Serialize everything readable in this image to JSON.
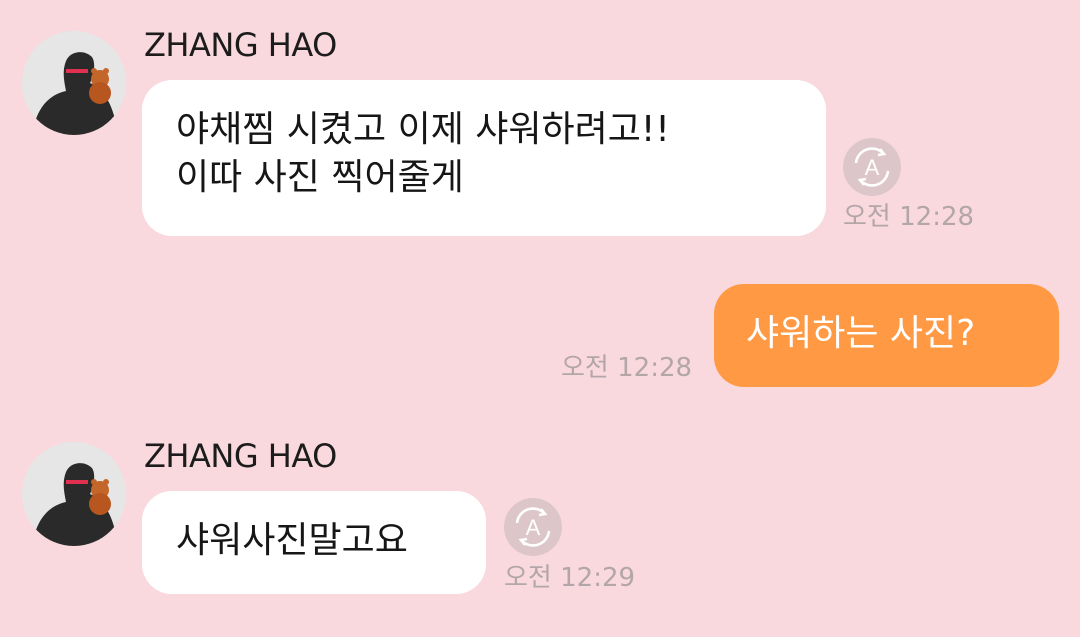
{
  "messages": [
    {
      "sender": "ZHANG HAO",
      "lines": [
        "야채찜 시켰고 이제 샤워하려고!!",
        "이따 사진 찍어줄게"
      ],
      "time": "오전 12:28",
      "translate_icon": "translate-a-icon"
    },
    {
      "from_me": true,
      "text": "샤워하는 사진?",
      "time": "오전 12:28"
    },
    {
      "sender": "ZHANG HAO",
      "text": "샤워사진말고요",
      "time": "오전 12:29",
      "translate_icon": "translate-a-icon"
    }
  ],
  "colors": {
    "background": "#f9d9de",
    "incoming_bubble": "#ffffff",
    "outgoing_bubble": "#ff9944",
    "timestamp": "#b3a6a9",
    "translate_button": "#dcc6ca"
  }
}
